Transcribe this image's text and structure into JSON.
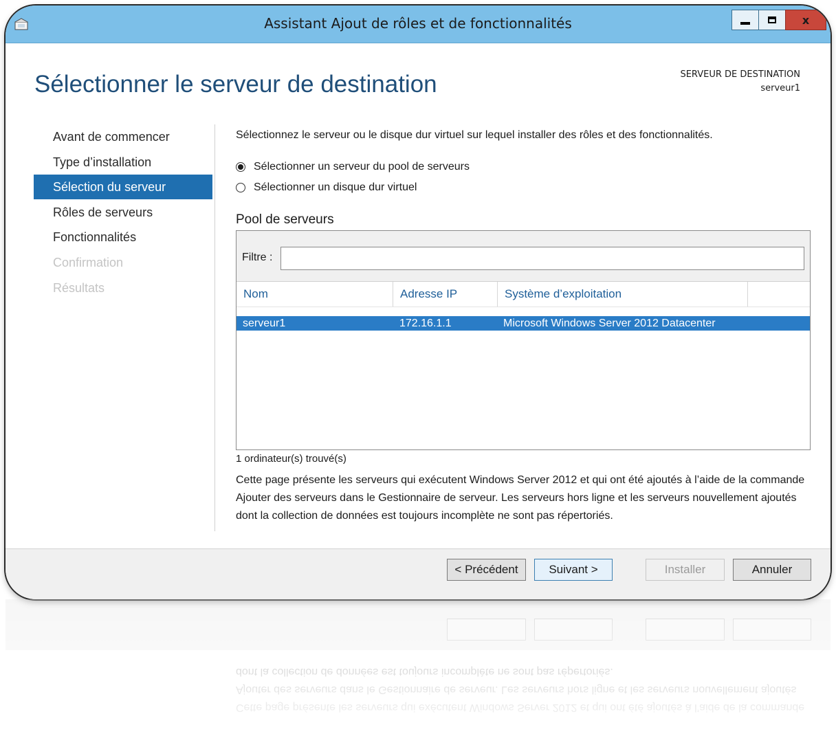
{
  "window": {
    "title": "Assistant Ajout de rôles et de fonctionnalités",
    "controls": {
      "minimize": "minimize-icon",
      "maximize": "maximize-icon",
      "close": "x"
    }
  },
  "header": {
    "page_title": "Sélectionner le serveur de destination",
    "destination_label": "SERVEUR DE DESTINATION",
    "destination_server": "serveur1"
  },
  "sidebar": {
    "items": [
      {
        "label": "Avant de commencer",
        "state": "normal"
      },
      {
        "label": "Type d’installation",
        "state": "normal"
      },
      {
        "label": "Sélection du serveur",
        "state": "active"
      },
      {
        "label": "Rôles de serveurs",
        "state": "normal"
      },
      {
        "label": "Fonctionnalités",
        "state": "normal"
      },
      {
        "label": "Confirmation",
        "state": "disabled"
      },
      {
        "label": "Résultats",
        "state": "disabled"
      }
    ]
  },
  "main": {
    "intro": "Sélectionnez le serveur ou le disque dur virtuel sur lequel installer des rôles et des fonctionnalités.",
    "options": [
      {
        "label": "Sélectionner un serveur du pool de serveurs",
        "selected": true
      },
      {
        "label": "Sélectionner un disque dur virtuel",
        "selected": false
      }
    ],
    "pool_label": "Pool de serveurs",
    "filter_label": "Filtre :",
    "filter_value": "",
    "columns": [
      "Nom",
      "Adresse IP",
      "Système d’exploitation"
    ],
    "rows": [
      {
        "name": "serveur1",
        "ip": "172.16.1.1",
        "os": "Microsoft Windows Server 2012 Datacenter",
        "selected": true
      }
    ],
    "count_text": "1 ordinateur(s) trouvé(s)",
    "description": "Cette page présente les serveurs qui exécutent Windows Server 2012 et qui ont été ajoutés à l’aide de la commande Ajouter des serveurs dans le Gestionnaire de serveur. Les serveurs hors ligne et les serveurs nouvellement ajoutés dont la collection de données est toujours incomplète ne sont pas répertoriés."
  },
  "footer": {
    "prev": "< Précédent",
    "next": "Suivant >",
    "install": "Installer",
    "cancel": "Annuler"
  },
  "colors": {
    "titlebar": "#7cbfe8",
    "accent": "#1f6fb0",
    "row_selected": "#2a7cc6",
    "title_text": "#1f4e79",
    "close_button": "#c8473b"
  }
}
